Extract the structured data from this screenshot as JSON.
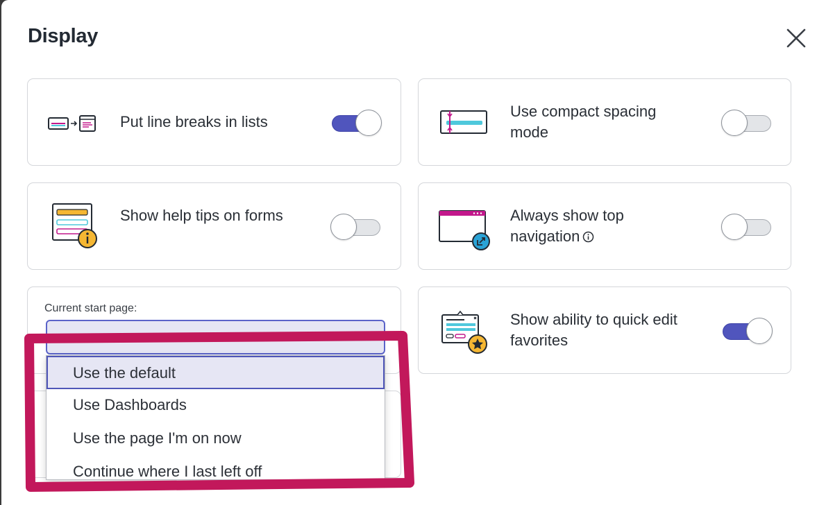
{
  "dialog": {
    "title": "Display",
    "close_label": "Close"
  },
  "settings": [
    {
      "label": "Put line breaks in lists",
      "state": "on"
    },
    {
      "label": "Use compact spacing mode",
      "state": "off"
    },
    {
      "label": "Show help tips on forms",
      "state": "off"
    },
    {
      "label": "Always show top navigation",
      "state": "off"
    },
    {
      "label": "Show ability to quick edit favorites",
      "state": "on"
    }
  ],
  "start_page": {
    "label": "Current start page:",
    "value": "",
    "options": [
      "Use the default",
      "Use Dashboards",
      "Use the page I'm on now",
      "Continue where I last left off"
    ],
    "selected_option": "Use the default"
  },
  "colors": {
    "accent": "#5055bd",
    "annotation": "#c2185b",
    "toggle_off": "#e3e5e8",
    "magenta": "#c2188b",
    "cyan": "#4fc8dc",
    "amber": "#f5b733",
    "link_blue": "#2aa3d6"
  },
  "icons": {
    "close": "close-icon",
    "line_breaks": "line-breaks-illustration",
    "compact": "compact-spacing-illustration",
    "help_tips": "help-tips-illustration",
    "top_nav": "top-navigation-illustration",
    "favorites": "quick-edit-favorites-illustration",
    "info": "info-icon",
    "caret": "chevron-down-icon"
  }
}
